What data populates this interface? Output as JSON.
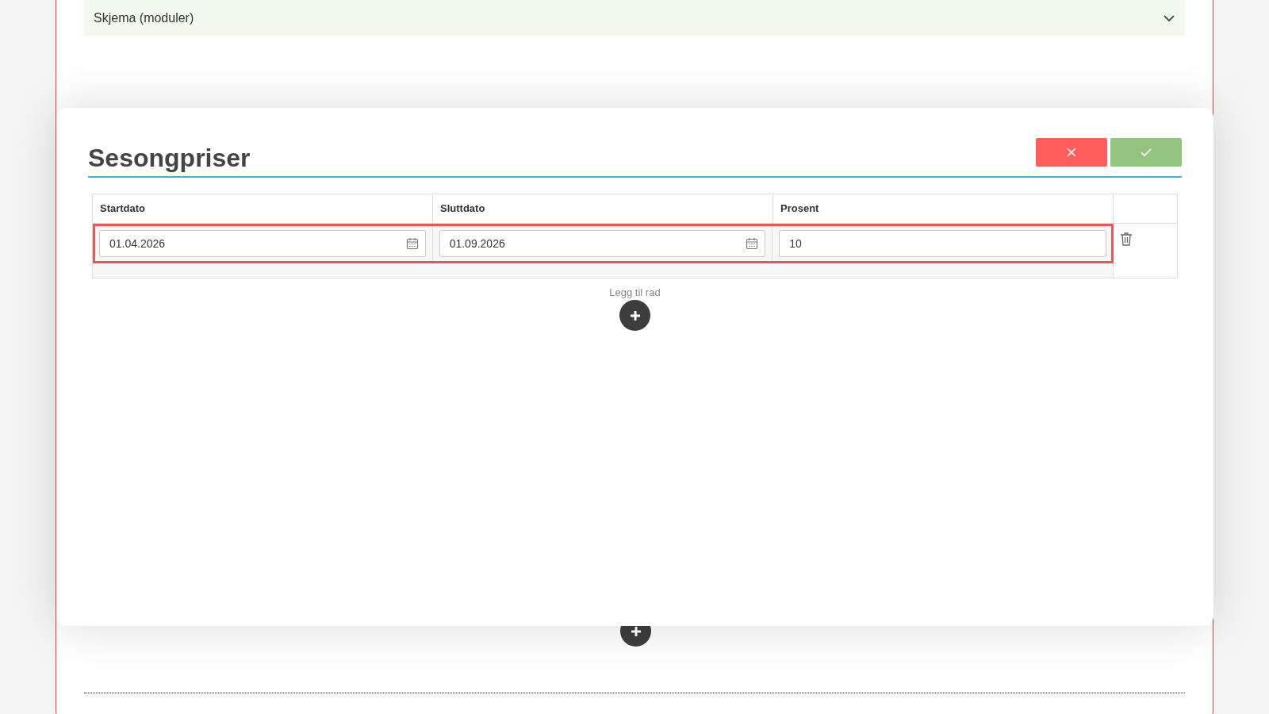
{
  "accordion": {
    "title": "Skjema (moduler)",
    "expanded": false
  },
  "modal": {
    "title": "Sesongpriser",
    "actions": [
      {
        "kind": "cancel"
      },
      {
        "kind": "confirm"
      }
    ],
    "table": {
      "columns": [
        "Startdato",
        "Sluttdato",
        "Prosent"
      ],
      "rows": [
        {
          "highlighted": true,
          "fields": [
            {
              "kind": "date",
              "value": "01.04.2026"
            },
            {
              "kind": "date",
              "value": "01.09.2026"
            },
            {
              "kind": "number",
              "value": "10"
            }
          ]
        }
      ]
    },
    "add_row": {
      "label": "Legg til rad"
    }
  }
}
